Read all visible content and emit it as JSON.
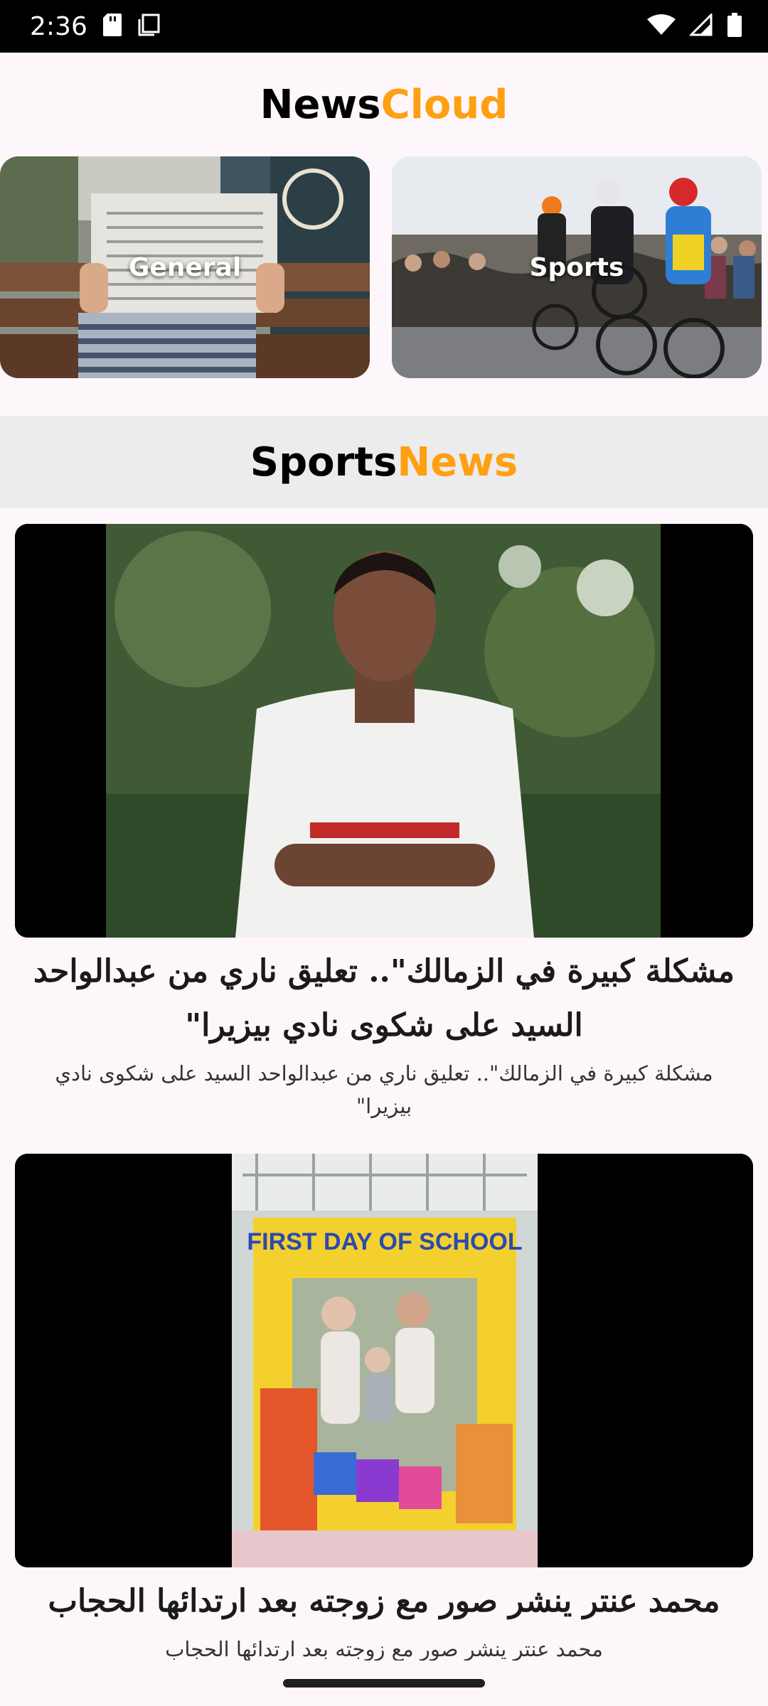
{
  "status_bar": {
    "time": "2:36",
    "icons": [
      "sd-card-icon",
      "screenshot-icon",
      "wifi-icon",
      "signal-icon",
      "battery-icon"
    ]
  },
  "app_title": {
    "part1": "News",
    "part2": "Cloud"
  },
  "colors": {
    "accent": "#ff9f12",
    "title": "#000000",
    "section_bg": "#ececec",
    "page_bg": "#fdf7fb"
  },
  "categories": [
    {
      "label": "General"
    },
    {
      "label": "Sports"
    }
  ],
  "section": {
    "part1": "Sports",
    "part2": "News"
  },
  "articles": [
    {
      "title": "مشكلة كبيرة في الزمالك\".. تعليق ناري من عبدالواحد السيد على شكوى نادي بيزيرا\"",
      "description": "مشكلة كبيرة في الزمالك\".. تعليق ناري من عبدالواحد السيد على شكوى نادي بيزيرا\""
    },
    {
      "title": "محمد عنتر ينشر صور مع زوجته بعد ارتدائها الحجاب",
      "description": "محمد عنتر ينشر صور مع زوجته بعد ارتدائها الحجاب",
      "image_caption": "FIRST DAY OF SCHOOL"
    }
  ]
}
